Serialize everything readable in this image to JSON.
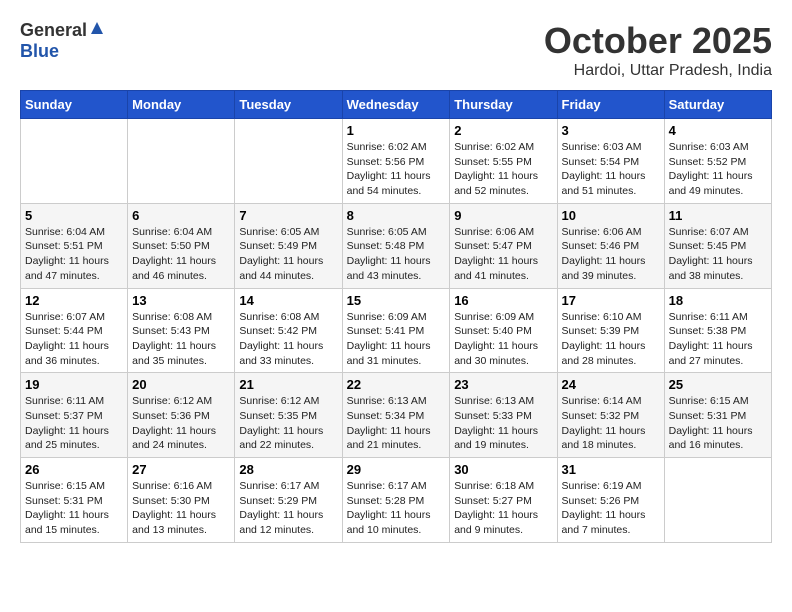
{
  "logo": {
    "general": "General",
    "blue": "Blue"
  },
  "title": "October 2025",
  "location": "Hardoi, Uttar Pradesh, India",
  "days_header": [
    "Sunday",
    "Monday",
    "Tuesday",
    "Wednesday",
    "Thursday",
    "Friday",
    "Saturday"
  ],
  "weeks": [
    [
      {
        "day": "",
        "info": ""
      },
      {
        "day": "",
        "info": ""
      },
      {
        "day": "",
        "info": ""
      },
      {
        "day": "1",
        "info": "Sunrise: 6:02 AM\nSunset: 5:56 PM\nDaylight: 11 hours\nand 54 minutes."
      },
      {
        "day": "2",
        "info": "Sunrise: 6:02 AM\nSunset: 5:55 PM\nDaylight: 11 hours\nand 52 minutes."
      },
      {
        "day": "3",
        "info": "Sunrise: 6:03 AM\nSunset: 5:54 PM\nDaylight: 11 hours\nand 51 minutes."
      },
      {
        "day": "4",
        "info": "Sunrise: 6:03 AM\nSunset: 5:52 PM\nDaylight: 11 hours\nand 49 minutes."
      }
    ],
    [
      {
        "day": "5",
        "info": "Sunrise: 6:04 AM\nSunset: 5:51 PM\nDaylight: 11 hours\nand 47 minutes."
      },
      {
        "day": "6",
        "info": "Sunrise: 6:04 AM\nSunset: 5:50 PM\nDaylight: 11 hours\nand 46 minutes."
      },
      {
        "day": "7",
        "info": "Sunrise: 6:05 AM\nSunset: 5:49 PM\nDaylight: 11 hours\nand 44 minutes."
      },
      {
        "day": "8",
        "info": "Sunrise: 6:05 AM\nSunset: 5:48 PM\nDaylight: 11 hours\nand 43 minutes."
      },
      {
        "day": "9",
        "info": "Sunrise: 6:06 AM\nSunset: 5:47 PM\nDaylight: 11 hours\nand 41 minutes."
      },
      {
        "day": "10",
        "info": "Sunrise: 6:06 AM\nSunset: 5:46 PM\nDaylight: 11 hours\nand 39 minutes."
      },
      {
        "day": "11",
        "info": "Sunrise: 6:07 AM\nSunset: 5:45 PM\nDaylight: 11 hours\nand 38 minutes."
      }
    ],
    [
      {
        "day": "12",
        "info": "Sunrise: 6:07 AM\nSunset: 5:44 PM\nDaylight: 11 hours\nand 36 minutes."
      },
      {
        "day": "13",
        "info": "Sunrise: 6:08 AM\nSunset: 5:43 PM\nDaylight: 11 hours\nand 35 minutes."
      },
      {
        "day": "14",
        "info": "Sunrise: 6:08 AM\nSunset: 5:42 PM\nDaylight: 11 hours\nand 33 minutes."
      },
      {
        "day": "15",
        "info": "Sunrise: 6:09 AM\nSunset: 5:41 PM\nDaylight: 11 hours\nand 31 minutes."
      },
      {
        "day": "16",
        "info": "Sunrise: 6:09 AM\nSunset: 5:40 PM\nDaylight: 11 hours\nand 30 minutes."
      },
      {
        "day": "17",
        "info": "Sunrise: 6:10 AM\nSunset: 5:39 PM\nDaylight: 11 hours\nand 28 minutes."
      },
      {
        "day": "18",
        "info": "Sunrise: 6:11 AM\nSunset: 5:38 PM\nDaylight: 11 hours\nand 27 minutes."
      }
    ],
    [
      {
        "day": "19",
        "info": "Sunrise: 6:11 AM\nSunset: 5:37 PM\nDaylight: 11 hours\nand 25 minutes."
      },
      {
        "day": "20",
        "info": "Sunrise: 6:12 AM\nSunset: 5:36 PM\nDaylight: 11 hours\nand 24 minutes."
      },
      {
        "day": "21",
        "info": "Sunrise: 6:12 AM\nSunset: 5:35 PM\nDaylight: 11 hours\nand 22 minutes."
      },
      {
        "day": "22",
        "info": "Sunrise: 6:13 AM\nSunset: 5:34 PM\nDaylight: 11 hours\nand 21 minutes."
      },
      {
        "day": "23",
        "info": "Sunrise: 6:13 AM\nSunset: 5:33 PM\nDaylight: 11 hours\nand 19 minutes."
      },
      {
        "day": "24",
        "info": "Sunrise: 6:14 AM\nSunset: 5:32 PM\nDaylight: 11 hours\nand 18 minutes."
      },
      {
        "day": "25",
        "info": "Sunrise: 6:15 AM\nSunset: 5:31 PM\nDaylight: 11 hours\nand 16 minutes."
      }
    ],
    [
      {
        "day": "26",
        "info": "Sunrise: 6:15 AM\nSunset: 5:31 PM\nDaylight: 11 hours\nand 15 minutes."
      },
      {
        "day": "27",
        "info": "Sunrise: 6:16 AM\nSunset: 5:30 PM\nDaylight: 11 hours\nand 13 minutes."
      },
      {
        "day": "28",
        "info": "Sunrise: 6:17 AM\nSunset: 5:29 PM\nDaylight: 11 hours\nand 12 minutes."
      },
      {
        "day": "29",
        "info": "Sunrise: 6:17 AM\nSunset: 5:28 PM\nDaylight: 11 hours\nand 10 minutes."
      },
      {
        "day": "30",
        "info": "Sunrise: 6:18 AM\nSunset: 5:27 PM\nDaylight: 11 hours\nand 9 minutes."
      },
      {
        "day": "31",
        "info": "Sunrise: 6:19 AM\nSunset: 5:26 PM\nDaylight: 11 hours\nand 7 minutes."
      },
      {
        "day": "",
        "info": ""
      }
    ]
  ]
}
